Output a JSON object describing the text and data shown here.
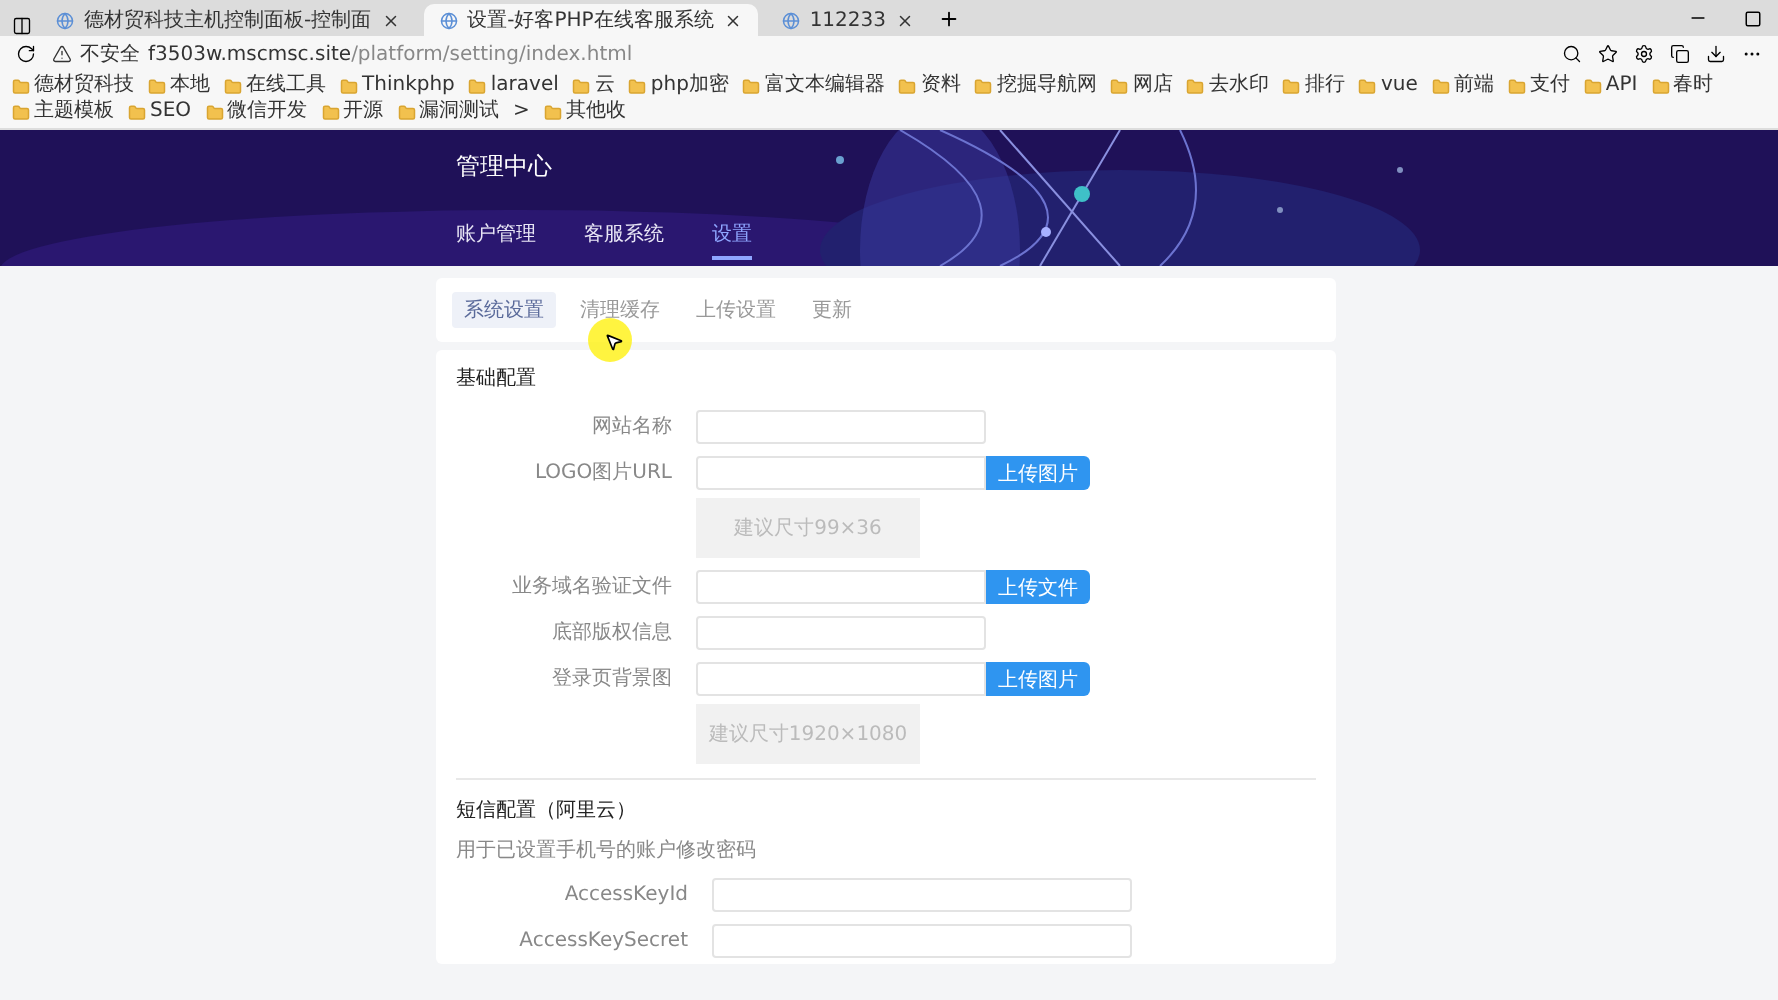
{
  "browser": {
    "tabs": [
      {
        "title": "德材贸科技主机控制面板-控制面",
        "selected": false
      },
      {
        "title": "设置-好客PHP在线客服系统",
        "selected": true
      },
      {
        "title": "112233",
        "selected": false
      }
    ],
    "address": {
      "security": "不安全",
      "host": "f3503w.mscmsc.site",
      "path": "/platform/setting/index.html"
    },
    "bookmarks": [
      "德材贸科技",
      "本地",
      "在线工具",
      "Thinkphp",
      "laravel",
      "云",
      "php加密",
      "富文本编辑器",
      "资料",
      "挖掘导航网",
      "网店",
      "去水印",
      "排行",
      "vue",
      "前端",
      "支付",
      "API",
      "春时",
      "主题模板",
      "SEO",
      "微信开发",
      "开源",
      "漏洞测试"
    ],
    "bookmarks_more": ">",
    "other_bookmarks": "其他收"
  },
  "header": {
    "title": "管理中心",
    "nav": [
      {
        "label": "账户管理",
        "selected": false
      },
      {
        "label": "客服系统",
        "selected": false
      },
      {
        "label": "设置",
        "selected": true
      }
    ]
  },
  "subtabs": [
    {
      "label": "系统设置",
      "selected": true
    },
    {
      "label": "清理缓存",
      "selected": false
    },
    {
      "label": "上传设置",
      "selected": false
    },
    {
      "label": "更新",
      "selected": false
    }
  ],
  "sections": [
    {
      "title": "基础配置",
      "fields": [
        {
          "kind": "text",
          "label": "网站名称"
        },
        {
          "kind": "upload",
          "label": "LOGO图片URL",
          "button": "上传图片",
          "preview": "建议尺寸99×36"
        },
        {
          "kind": "upload",
          "label": "业务域名验证文件",
          "button": "上传文件"
        },
        {
          "kind": "text",
          "label": "底部版权信息"
        },
        {
          "kind": "upload",
          "label": "登录页背景图",
          "button": "上传图片",
          "preview": "建议尺寸1920×1080"
        }
      ]
    },
    {
      "title": "短信配置（阿里云）",
      "description": "用于已设置手机号的账户修改密码",
      "fields": [
        {
          "kind": "wide",
          "label": "AccessKeyId"
        },
        {
          "kind": "wide",
          "label": "AccessKeySecret"
        }
      ]
    }
  ]
}
